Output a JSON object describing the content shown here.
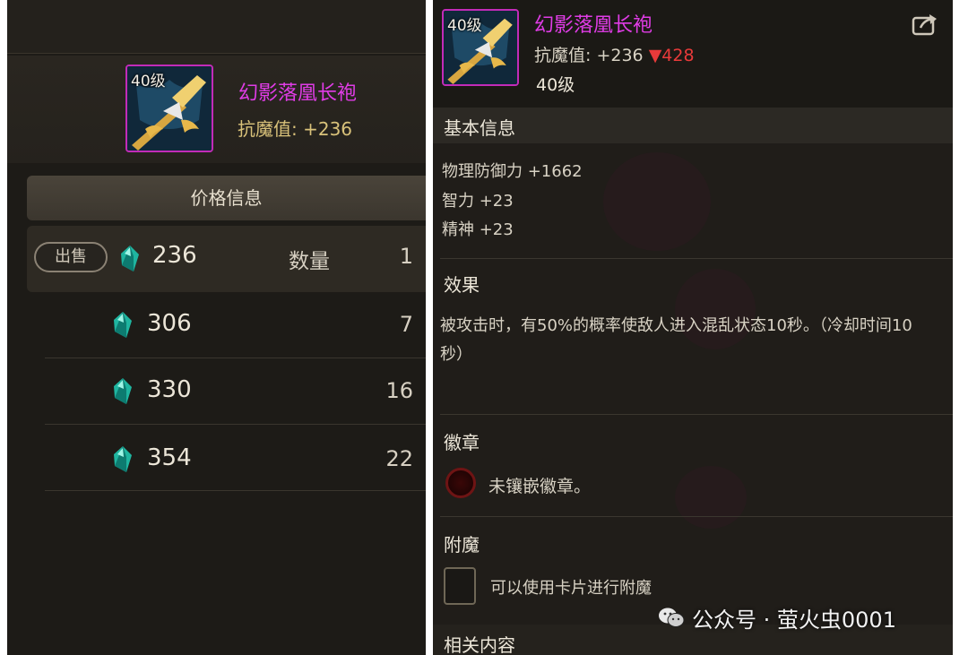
{
  "left_panel": {
    "item": {
      "level_badge": "40级",
      "name": "幻影落凰长袍",
      "stat_text": "抗魔值: +236"
    },
    "price_header": "价格信息",
    "sell_button": "出售",
    "quantity_label": "数量",
    "listings": [
      {
        "price": "236",
        "quantity": "1"
      },
      {
        "price": "306",
        "quantity": "7"
      },
      {
        "price": "330",
        "quantity": "16"
      },
      {
        "price": "354",
        "quantity": "22"
      }
    ]
  },
  "right_panel": {
    "item": {
      "level_badge": "40级",
      "name": "幻影落凰长袍",
      "stat_prefix": "抗魔值: +236",
      "stat_diff": "▼428",
      "level_text": "40级"
    },
    "sections": {
      "basic_title": "基本信息",
      "basic_lines": [
        "物理防御力 +1662",
        "智力 +23",
        "精神 +23"
      ],
      "effect_title": "效果",
      "effect_text": "被攻击时，有50%的概率使敌人进入混乱状态10秒。（冷却时间10秒）",
      "badge_title": "徽章",
      "badge_text": "未镶嵌徽章。",
      "enchant_title": "附魔",
      "enchant_text": "可以使用卡片进行附魔",
      "related_title": "相关内容"
    }
  },
  "watermark": "公众号 · 萤火虫0001",
  "colors": {
    "item_name": "#e03ce6",
    "stat_value": "#d9c27a",
    "diff_down": "#e83a3a",
    "panel_bg": "#201d19"
  },
  "icons": [
    "gem-icon",
    "share-icon",
    "wechat-icon",
    "socket-icon"
  ]
}
